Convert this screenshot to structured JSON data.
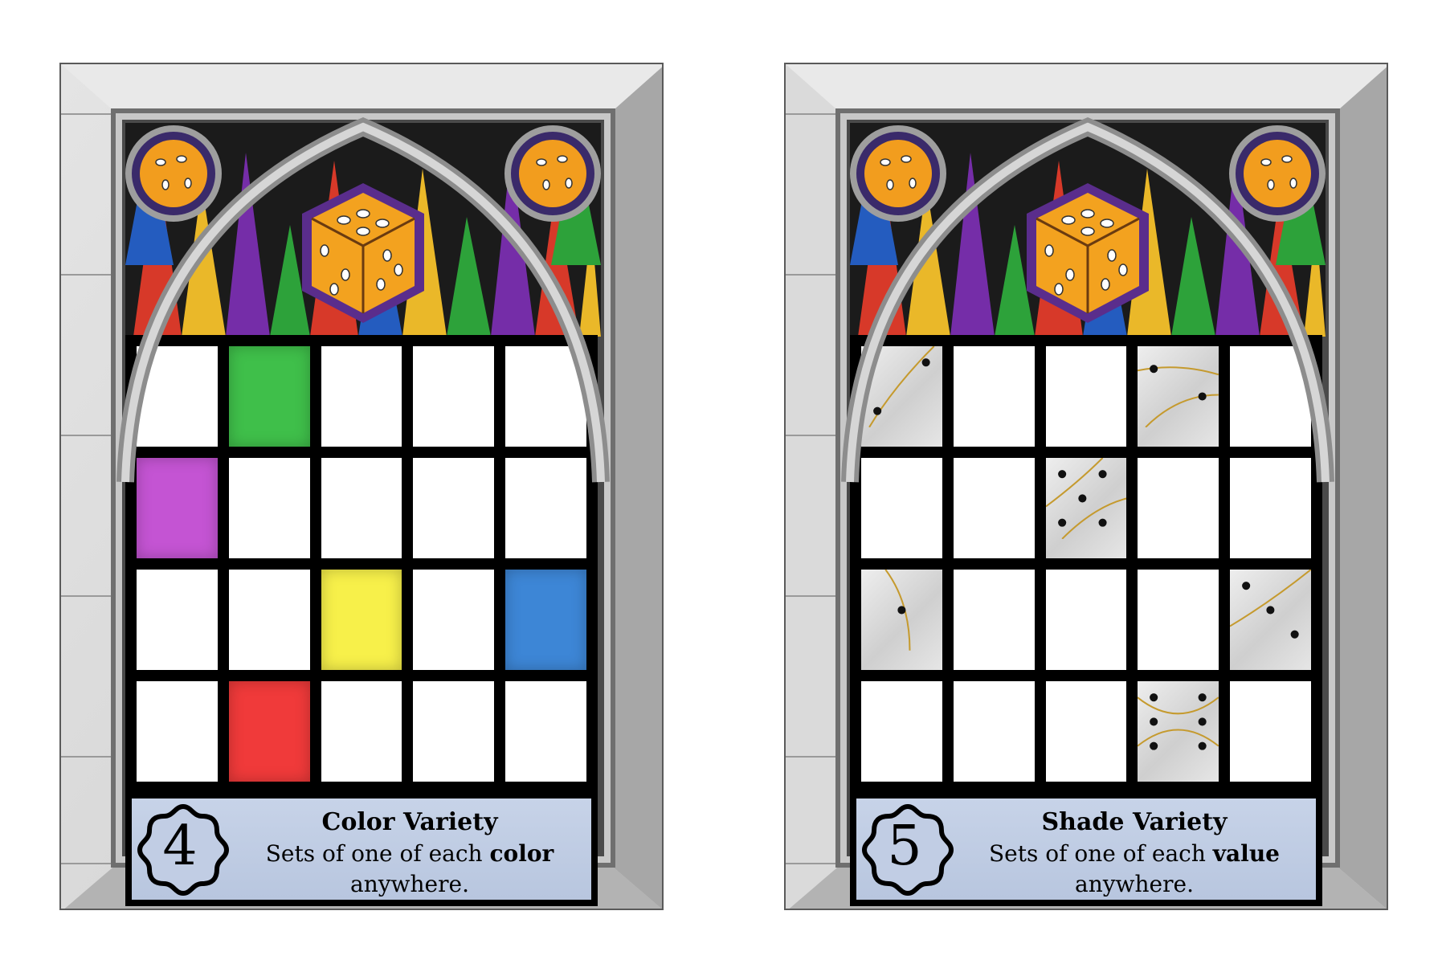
{
  "colors": {
    "green": "#3fbf4a",
    "purple": "#c454d3",
    "yellow": "#f7f04a",
    "blue": "#3d86d6",
    "red": "#f03a3a",
    "panel": "#c1cde4",
    "stone": "#d9d9d9",
    "stone_dark": "#a9a9a9"
  },
  "cards": [
    {
      "number": "4",
      "title": "Color Variety",
      "desc_before": "Sets of one of each ",
      "desc_bold": "color",
      "desc_after": " anywhere.",
      "cells": [
        [
          "",
          "green",
          "",
          "",
          ""
        ],
        [
          "purple",
          "",
          "",
          "",
          ""
        ],
        [
          "",
          "",
          "yellow",
          "",
          "blue"
        ],
        [
          "",
          "red",
          "",
          "",
          ""
        ]
      ]
    },
    {
      "number": "5",
      "title": "Shade Variety",
      "desc_before": "Sets of one of each ",
      "desc_bold": "value",
      "desc_after": " anywhere.",
      "cells": [
        [
          "shade",
          "",
          "",
          "shade",
          ""
        ],
        [
          "",
          "",
          "shade",
          "",
          ""
        ],
        [
          "shade",
          "",
          "",
          "",
          "shade"
        ],
        [
          "",
          "",
          "",
          "shade",
          ""
        ]
      ]
    }
  ]
}
